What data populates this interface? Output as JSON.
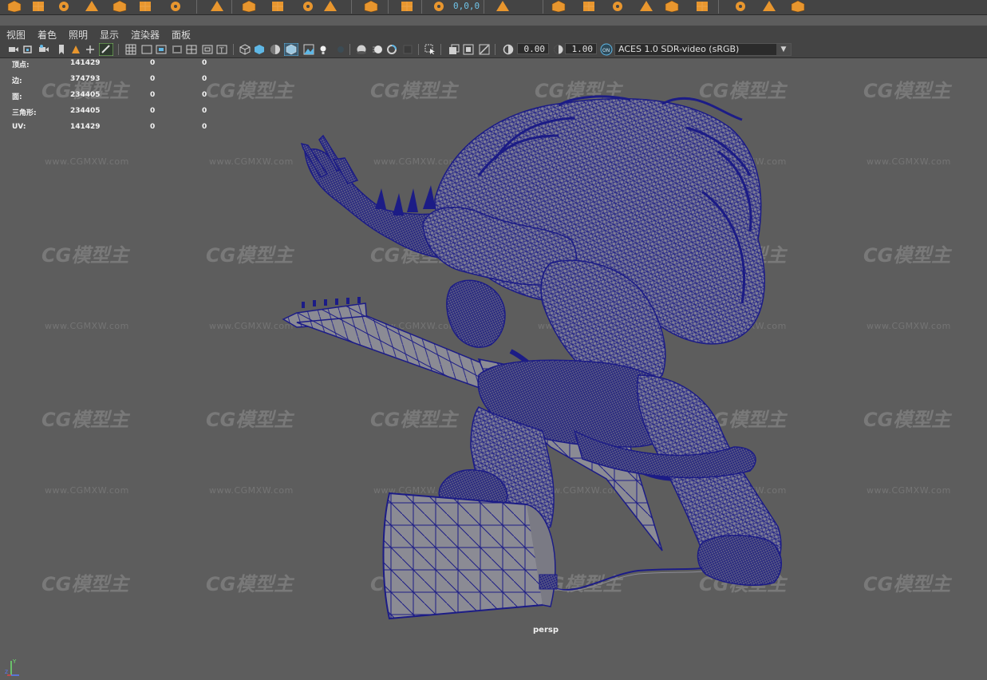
{
  "shelf": {
    "readout": "0,0,0",
    "icons": [
      "sphere-icon",
      "cube-icon",
      "cylinder-icon",
      "cone-icon",
      "plane-icon",
      "torus-icon",
      "boolean-icon",
      "smooth-icon",
      "extrude-icon",
      "bridge-icon",
      "text-icon",
      "svg-icon",
      "uv-editor-icon",
      "camera-icon",
      "transform-icon",
      "group-icon",
      "component-icon",
      "mirror-icon",
      "combine-icon",
      "separate-icon",
      "fill-icon",
      "append-icon",
      "multicut-icon",
      "bevel-icon",
      "target-weld-icon"
    ]
  },
  "panel_menu": {
    "view": "视图",
    "shading": "着色",
    "lighting": "照明",
    "show": "显示",
    "renderer": "渲染器",
    "panels": "面板"
  },
  "panel_toolbar": {
    "exposure": "0.00",
    "gamma": "1.00",
    "color_management_icon": "ocio-icon",
    "view_transform": "ACES 1.0 SDR-video (sRGB)"
  },
  "hud": {
    "rows": [
      {
        "label": "顶点:",
        "v1": "141429",
        "v2": "0",
        "v3": "0"
      },
      {
        "label": "边:",
        "v1": "374793",
        "v2": "0",
        "v3": "0"
      },
      {
        "label": "面:",
        "v1": "234405",
        "v2": "0",
        "v3": "0"
      },
      {
        "label": "三角形:",
        "v1": "234405",
        "v2": "0",
        "v3": "0"
      },
      {
        "label": "UV:",
        "v1": "141429",
        "v2": "0",
        "v3": "0"
      }
    ]
  },
  "viewport": {
    "camera": "persp",
    "axis_y": "Y",
    "axis_z": "Z",
    "wireframe_color": "#1c1c86",
    "shaded_color": "#8a8a94"
  },
  "watermark": {
    "logo": "CG模型主",
    "url": "www.CGMXW.com"
  },
  "colors": {
    "viewport_bg": "#5d5d5d",
    "panel_bg": "#444444",
    "accent_orange": "#e8962e",
    "accent_blue": "#5fb7e5"
  }
}
